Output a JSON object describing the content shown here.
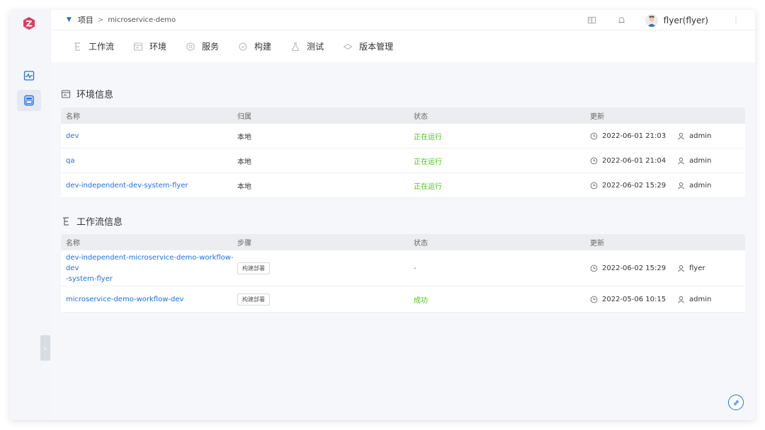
{
  "breadcrumb": {
    "project": "项目",
    "separator": ">",
    "name": "microservice-demo"
  },
  "user": {
    "name": "flyer(flyer)"
  },
  "tabs": [
    {
      "label": "工作流",
      "icon": "workflow-icon"
    },
    {
      "label": "环境",
      "icon": "environment-icon"
    },
    {
      "label": "服务",
      "icon": "service-icon"
    },
    {
      "label": "构建",
      "icon": "build-icon"
    },
    {
      "label": "测试",
      "icon": "test-icon"
    },
    {
      "label": "版本管理",
      "icon": "version-icon"
    }
  ],
  "env_section": {
    "title": "环境信息",
    "headers": [
      "名称",
      "归属",
      "状态",
      "更新"
    ],
    "rows": [
      {
        "name": "dev",
        "owner": "本地",
        "status": "正在运行",
        "time": "2022-06-01 21:03",
        "user": "admin"
      },
      {
        "name": "qa",
        "owner": "本地",
        "status": "正在运行",
        "time": "2022-06-01 21:04",
        "user": "admin"
      },
      {
        "name": "dev-independent-dev-system-flyer",
        "owner": "本地",
        "status": "正在运行",
        "time": "2022-06-02 15:29",
        "user": "admin"
      }
    ]
  },
  "workflow_section": {
    "title": "工作流信息",
    "headers": [
      "名称",
      "步骤",
      "状态",
      "更新"
    ],
    "rows": [
      {
        "name_line1": "dev-independent-microservice-demo-workflow-dev",
        "name_line2": "-system-flyer",
        "step": "构建部署",
        "status": "-",
        "time": "2022-06-02 15:29",
        "user": "flyer"
      },
      {
        "name_line1": "microservice-demo-workflow-dev",
        "name_line2": "",
        "step": "构建部署",
        "status": "成功",
        "time": "2022-05-06 10:15",
        "user": "admin"
      }
    ]
  },
  "colors": {
    "accent": "#1f6fe8",
    "success": "#52c41a",
    "logo": "#e23b5c"
  }
}
